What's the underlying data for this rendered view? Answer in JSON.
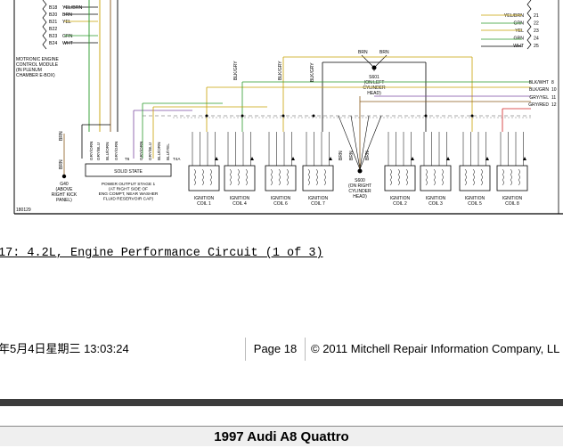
{
  "diagram": {
    "figure_id": "180129",
    "ecm_pins": [
      {
        "pin": "B18",
        "color": "YEL/BRN"
      },
      {
        "pin": "B20",
        "color": "BRN"
      },
      {
        "pin": "B21",
        "color": "YEL"
      },
      {
        "pin": "B22",
        "color": ""
      },
      {
        "pin": "B23",
        "color": "GRN"
      },
      {
        "pin": "B24",
        "color": "WHT"
      }
    ],
    "ecm_label": [
      "MOTRONIC ENGINE",
      "CONTROL MODULE",
      "(IN PLENUM",
      "CHAMBER E-BOX)"
    ],
    "right_pins": [
      {
        "color": "YEL/BRN",
        "pin": "21"
      },
      {
        "color": "GRN",
        "pin": "22"
      },
      {
        "color": "YEL",
        "pin": "23"
      },
      {
        "color": "GRN",
        "pin": "24"
      },
      {
        "color": "WHT",
        "pin": "25"
      }
    ],
    "right_wires": [
      {
        "color": "BLK/WHT",
        "pin": "8"
      },
      {
        "color": "BLK/GRN",
        "pin": "10"
      },
      {
        "color": "GRY/YEL",
        "pin": "11"
      },
      {
        "color": "GRY/RED",
        "pin": "12"
      }
    ],
    "splice_left": [
      "S601",
      "(ON LEFT",
      "CYLINDER",
      "HEAD)"
    ],
    "splice_right": [
      "S600",
      "(ON RIGHT",
      "CYLINDER",
      "HEAD)"
    ],
    "ground": [
      "G40",
      "(ABOVE",
      "RIGHT KICK",
      "PANEL)"
    ],
    "stage_box": [
      "SOLID STATE"
    ],
    "stage_label": [
      "POWER OUTPUT STAGE 1",
      "(AT RIGHT SIDE OF",
      "ENG COMPT, NEAR WASHER",
      "FLUID RESERVOIR CAP)"
    ],
    "coils": [
      {
        "name": "IGNITION",
        "num": "COIL 1"
      },
      {
        "name": "IGNITION",
        "num": "COIL 4"
      },
      {
        "name": "IGNITION",
        "num": "COIL 6"
      },
      {
        "name": "IGNITION",
        "num": "COIL 7"
      },
      {
        "name": "IGNITION",
        "num": "COIL 2"
      },
      {
        "name": "IGNITION",
        "num": "COIL 3"
      },
      {
        "name": "IGNITION",
        "num": "COIL 5"
      },
      {
        "name": "IGNITION",
        "num": "COIL 8"
      }
    ]
  },
  "caption": "17: 4.2L, Engine Performance Circuit (1 of 3)",
  "footer": {
    "date": "年5月4日星期三  13:03:24",
    "page": "Page 18",
    "copyright": "© 2011 Mitchell Repair Information Company, LL"
  },
  "vehicle_title": "1997 Audi A8 Quattro"
}
